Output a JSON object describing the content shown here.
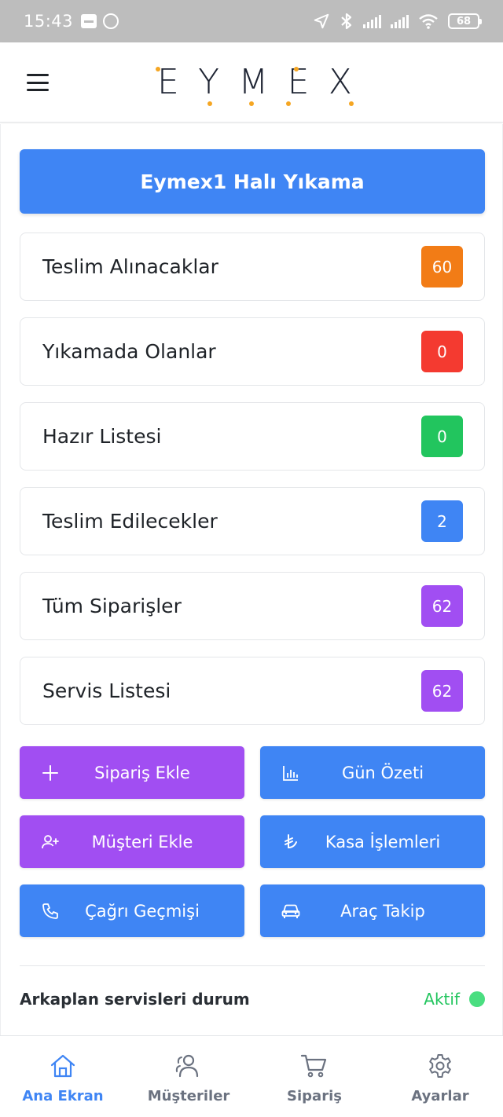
{
  "status_bar": {
    "time": "15:43",
    "battery": "68"
  },
  "header": {
    "logo_letters": [
      "E",
      "Y",
      "M",
      "E",
      "X"
    ]
  },
  "business_name": "Eymex1 Halı Yıkama",
  "status_cards": [
    {
      "label": "Teslim Alınacaklar",
      "count": "60",
      "color": "#f27c16"
    },
    {
      "label": "Yıkamada Olanlar",
      "count": "0",
      "color": "#f43a30"
    },
    {
      "label": "Hazır Listesi",
      "count": "0",
      "color": "#22c55e"
    },
    {
      "label": "Teslim Edilecekler",
      "count": "2",
      "color": "#3f85f4"
    },
    {
      "label": "Tüm Siparişler",
      "count": "62",
      "color": "#a14ef2"
    },
    {
      "label": "Servis Listesi",
      "count": "62",
      "color": "#a14ef2"
    }
  ],
  "actions": [
    {
      "label": "Sipariş Ekle",
      "icon": "plus-icon"
    },
    {
      "label": "Gün Özeti",
      "icon": "bar-chart-icon"
    },
    {
      "label": "Müşteri Ekle",
      "icon": "user-plus-icon"
    },
    {
      "label": "Kasa İşlemleri",
      "icon": "lira-icon"
    },
    {
      "label": "Çağrı Geçmişi",
      "icon": "phone-icon"
    },
    {
      "label": "Araç Takip",
      "icon": "car-icon"
    }
  ],
  "background_services": {
    "label": "Arkaplan servisleri durum",
    "status": "Aktif"
  },
  "bottom_nav": [
    {
      "label": "Ana Ekran",
      "icon": "home-icon",
      "active": true
    },
    {
      "label": "Müşteriler",
      "icon": "users-icon",
      "active": false
    },
    {
      "label": "Sipariş",
      "icon": "cart-icon",
      "active": false
    },
    {
      "label": "Ayarlar",
      "icon": "gear-icon",
      "active": false
    }
  ]
}
